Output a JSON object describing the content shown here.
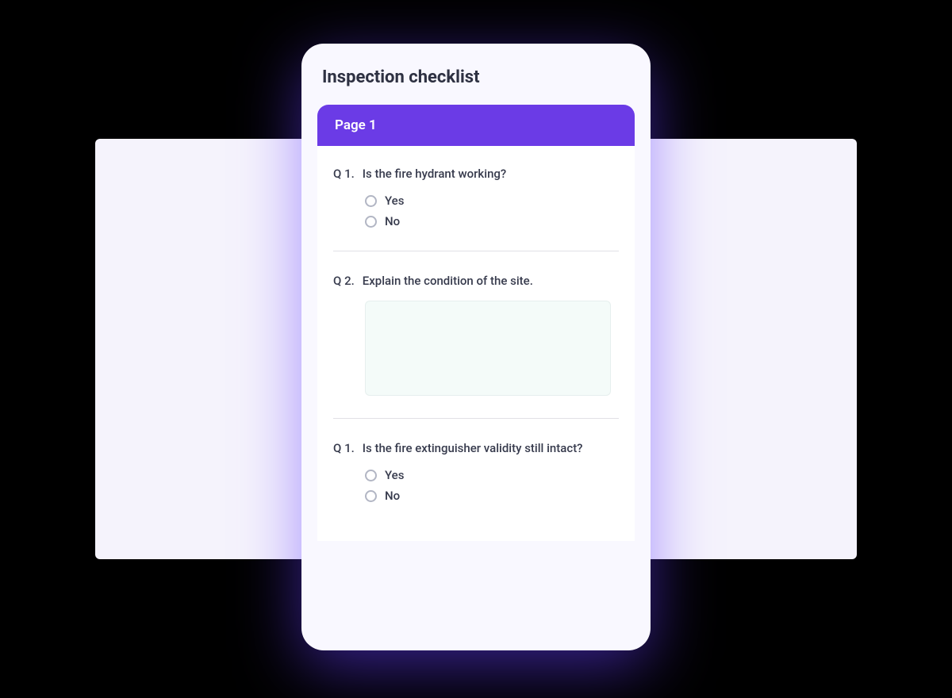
{
  "title": "Inspection checklist",
  "page_label": "Page 1",
  "questions": [
    {
      "num": "Q 1.",
      "text": "Is the fire hydrant working?",
      "type": "radio",
      "options": [
        "Yes",
        "No"
      ]
    },
    {
      "num": "Q 2.",
      "text": "Explain the condition of the site.",
      "type": "textarea"
    },
    {
      "num": "Q 1.",
      "text": "Is the fire extinguisher validity still intact?",
      "type": "radio",
      "options": [
        "Yes",
        "No"
      ]
    }
  ]
}
